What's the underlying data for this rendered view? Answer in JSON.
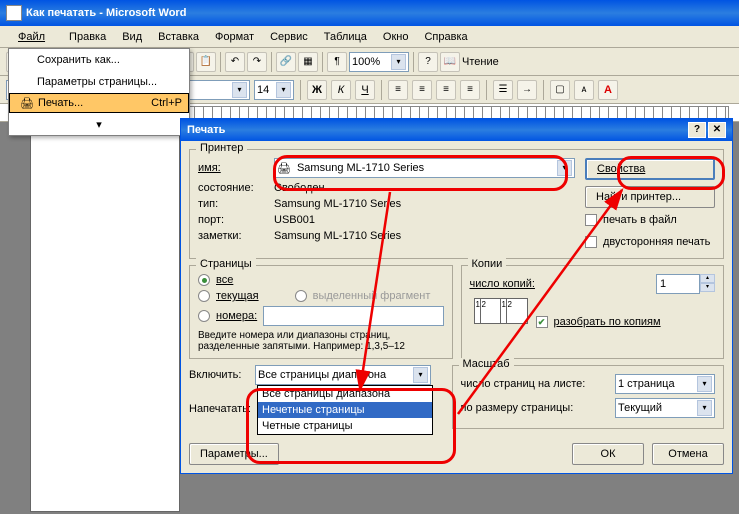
{
  "titlebar": {
    "title": "Как печатать - Microsoft Word"
  },
  "menubar": {
    "file": "Файл",
    "edit": "Правка",
    "view": "Вид",
    "insert": "Вставка",
    "format": "Формат",
    "service": "Сервис",
    "table": "Таблица",
    "window": "Окно",
    "help": "Справка"
  },
  "dropdown": {
    "save_as": "Сохранить как...",
    "page_setup": "Параметры страницы...",
    "print": "Печать...",
    "print_shortcut": "Ctrl+P",
    "expand": "▾"
  },
  "toolbar": {
    "zoom": "100%",
    "font_size": "14",
    "read": "Чтение"
  },
  "dialog": {
    "title": "Печать",
    "help": "?",
    "close": "✕",
    "printer": {
      "group": "Принтер",
      "name_lbl": "имя:",
      "name_val": "Samsung ML-1710 Series",
      "state_lbl": "состояние:",
      "state_val": "Свободен",
      "type_lbl": "тип:",
      "type_val": "Samsung ML-1710 Series",
      "port_lbl": "порт:",
      "port_val": "USB001",
      "notes_lbl": "заметки:",
      "notes_val": "Samsung ML-1710 Series",
      "properties": "Свойства",
      "find": "Найти принтер...",
      "to_file": "печать в файл",
      "duplex": "двусторонняя печать"
    },
    "pages": {
      "group": "Страницы",
      "all": "все",
      "current": "текущая",
      "selection": "выделенный фрагмент",
      "numbers": "номера:",
      "hint": "Введите номера или диапазоны страниц, разделенные запятыми. Например: 1,3,5–12"
    },
    "copies": {
      "group": "Копии",
      "count_lbl": "число копий:",
      "count_val": "1",
      "collate": "разобрать по копиям"
    },
    "include": {
      "include_lbl": "Включить:",
      "print_lbl": "Напечатать:",
      "selected": "Все страницы диапазона",
      "options": [
        "Все страницы диапазона",
        "Нечетные страницы",
        "Четные страницы"
      ]
    },
    "scale": {
      "group": "Масштаб",
      "pps_lbl": "число страниц на листе:",
      "pps_val": "1 страница",
      "size_lbl": "по размеру страницы:",
      "size_val": "Текущий"
    },
    "params": "Параметры...",
    "ok": "ОК",
    "cancel": "Отмена"
  }
}
